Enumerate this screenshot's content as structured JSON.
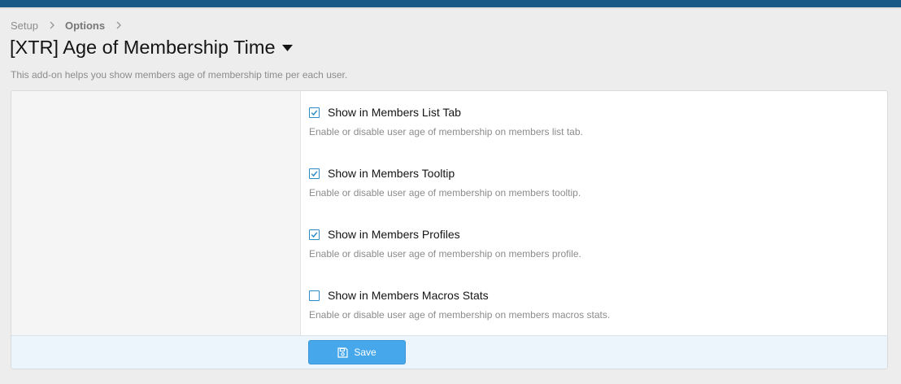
{
  "colors": {
    "top_bar": "#185886",
    "accent": "#47a7eb",
    "checkbox_border": "#2e8bc7",
    "footer_bg": "#edf5fc"
  },
  "breadcrumb": {
    "items": [
      {
        "label": "Setup"
      },
      {
        "label": "Options"
      }
    ],
    "separator_icon": "chevron-right-icon"
  },
  "page": {
    "title": "[XTR] Age of Membership Time",
    "title_menu_icon": "caret-down-icon",
    "description": "This add-on helps you show members age of membership time per each user."
  },
  "options": [
    {
      "label": "Show in Members List Tab",
      "hint": "Enable or disable user age of membership on members list tab.",
      "checked": true
    },
    {
      "label": "Show in Members Tooltip",
      "hint": "Enable or disable user age of membership on members tooltip.",
      "checked": true
    },
    {
      "label": "Show in Members Profiles",
      "hint": "Enable or disable user age of membership on members profile.",
      "checked": true
    },
    {
      "label": "Show in Members Macros Stats",
      "hint": "Enable or disable user age of membership on members macros stats.",
      "checked": false
    }
  ],
  "footer": {
    "save_label": "Save",
    "save_icon": "save-icon"
  }
}
